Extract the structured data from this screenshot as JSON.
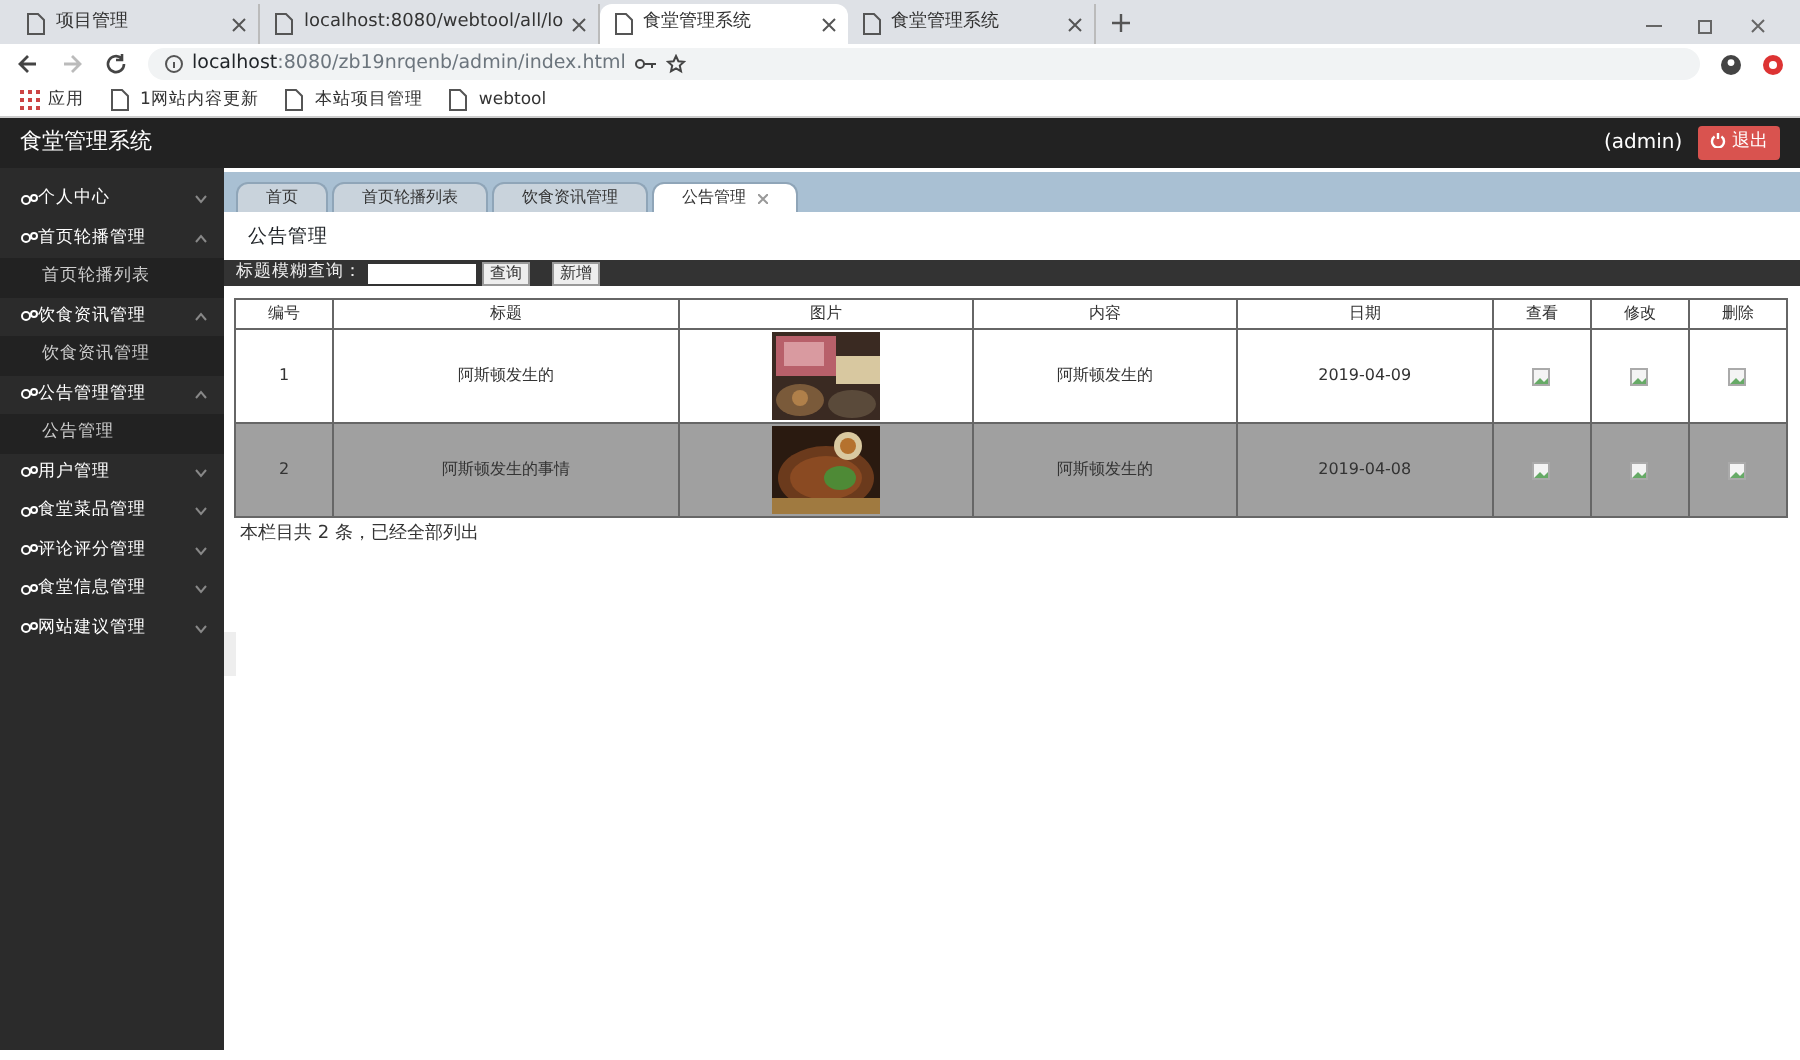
{
  "browser": {
    "tabs": [
      {
        "title": "项目管理",
        "selected": false
      },
      {
        "title": "localhost:8080/webtool/all/lo",
        "selected": false
      },
      {
        "title": "食堂管理系统",
        "selected": true
      },
      {
        "title": "食堂管理系统",
        "selected": false
      }
    ],
    "url_host": "localhost",
    "url_rest": ":8080/zb19nrqenb/admin/index.html",
    "bookmarks": [
      "应用",
      "1网站内容更新",
      "本站项目管理",
      "webtool"
    ]
  },
  "app": {
    "title": "食堂管理系统",
    "user": "(admin)",
    "logout": "退出"
  },
  "sidebar": {
    "items": [
      {
        "label": "个人中心",
        "expanded": false
      },
      {
        "label": "首页轮播管理",
        "expanded": true,
        "children": [
          {
            "label": "首页轮播列表"
          }
        ]
      },
      {
        "label": "饮食资讯管理",
        "expanded": true,
        "children": [
          {
            "label": "饮食资讯管理"
          }
        ]
      },
      {
        "label": "公告管理管理",
        "expanded": true,
        "children": [
          {
            "label": "公告管理"
          }
        ]
      },
      {
        "label": "用户管理",
        "expanded": false
      },
      {
        "label": "食堂菜品管理",
        "expanded": false
      },
      {
        "label": "评论评分管理",
        "expanded": false
      },
      {
        "label": "食堂信息管理",
        "expanded": false
      },
      {
        "label": "网站建议管理",
        "expanded": false
      }
    ]
  },
  "tabs": [
    {
      "label": "首页",
      "selected": false,
      "closable": false
    },
    {
      "label": "首页轮播列表",
      "selected": false,
      "closable": false
    },
    {
      "label": "饮食资讯管理",
      "selected": false,
      "closable": false
    },
    {
      "label": "公告管理",
      "selected": true,
      "closable": true
    }
  ],
  "page": {
    "heading": "公告管理",
    "search_label": "标题模糊查询：",
    "search_button": "查询",
    "add_button": "新增",
    "table": {
      "columns": [
        "编号",
        "标题",
        "图片",
        "内容",
        "日期",
        "查看",
        "修改",
        "删除"
      ],
      "rows": [
        {
          "id": "1",
          "title": "阿斯顿发生的",
          "content": "阿斯顿发生的",
          "date": "2019-04-09",
          "highlighted": false
        },
        {
          "id": "2",
          "title": "阿斯顿发生的事情",
          "content": "阿斯顿发生的",
          "date": "2019-04-08",
          "highlighted": true
        }
      ]
    },
    "footer": "本栏目共 2 条，已经全部列出"
  }
}
